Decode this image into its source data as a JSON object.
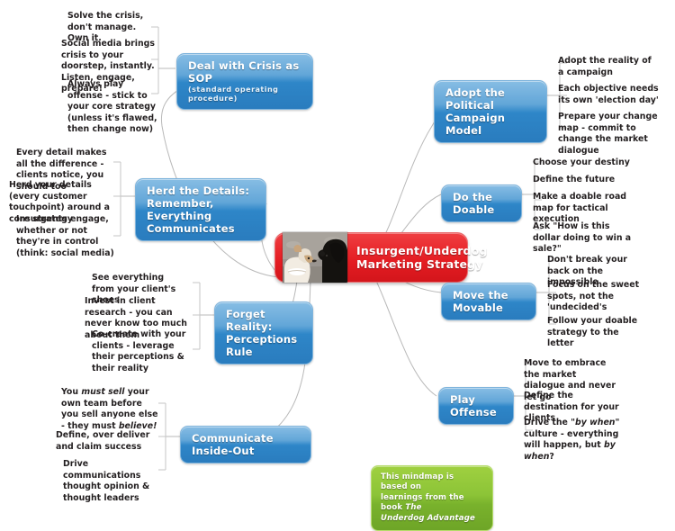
{
  "central": {
    "title": "Insurgent/Underdog\nMarketing Strategy",
    "photo_alt": "two-dogs-photo",
    "color": "#e31c22"
  },
  "footer_note": {
    "line1": "This mindmap is based on",
    "line2_plain": "learnings from the book ",
    "line2_italic": "The",
    "line3_italic": "Underdog Advantage",
    "color": "#8cc437"
  },
  "colors": {
    "node_blue": "#2e86c8",
    "node_red": "#e31c22",
    "node_green": "#8cc437",
    "link": "#b6b6b6",
    "text": "#231f20"
  },
  "branches": [
    {
      "id": "deal-with-crisis",
      "label": "Deal with Crisis as SOP",
      "sublabel": "(standard operating procedure)",
      "items": [
        "Solve the crisis, don't manage. Own it.",
        "Social media brings crisis to your doorstep, instantly. Listen, engage, prepare!",
        "Always play offense - stick to your core strategy (unless it's flawed, then change now)"
      ]
    },
    {
      "id": "herd-the-details",
      "label": "Herd the Details: Remember, Everything Communicates",
      "items": [
        "Every detail makes all the difference - clients notice, you should too",
        "Herd your details (every customer touchpoint) around a core strategy",
        "Insurgents engage, whether or not they're in control (think: social media)"
      ]
    },
    {
      "id": "forget-reality",
      "label": "Forget Reality: Perceptions Rule",
      "items": [
        "See everything from your client's shoes",
        "Invest in client research - you can never know too much about them",
        "Co-create with your clients - leverage their perceptions & their reality"
      ]
    },
    {
      "id": "communicate-inside-out",
      "label": "Communicate Inside-Out",
      "items": [
        "You must sell your own team before you sell anyone else - they must believe!",
        "Define, over deliver and claim success",
        "Drive communications thought opinion & thought leaders"
      ]
    },
    {
      "id": "adopt-political-campaign-model",
      "label": "Adopt the Political Campaign Model",
      "items": [
        "Adopt the reality of a campaign",
        "Each objective needs its own 'election day'",
        "Prepare your change map - commit to change the market dialogue"
      ]
    },
    {
      "id": "do-the-doable",
      "label": "Do the Doable",
      "items": [
        "Choose your destiny",
        "Define the future",
        "Make a doable road map for tactical execution",
        "Ask \"How is this dollar doing to win a sale?\""
      ]
    },
    {
      "id": "move-the-movable",
      "label": "Move the Movable",
      "items": [
        "Don't break your back on the impossible",
        "Focus on the sweet spots, not the 'undecided's",
        "Follow your doable strategy to the letter"
      ]
    },
    {
      "id": "play-offense",
      "label": "Play Offense",
      "items": [
        "Move to embrace the market dialogue and never let go",
        "Define the destination for your clients",
        "Drive the \"by when\" culture - everything will happen, but by when?"
      ]
    }
  ]
}
